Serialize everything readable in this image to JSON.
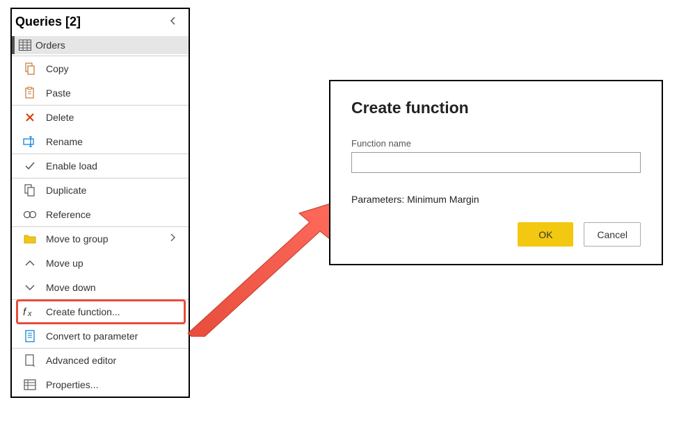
{
  "panel": {
    "title": "Queries [2]",
    "query_name": "Orders"
  },
  "menu": {
    "copy": "Copy",
    "paste": "Paste",
    "delete": "Delete",
    "rename": "Rename",
    "enable_load": "Enable load",
    "duplicate": "Duplicate",
    "reference": "Reference",
    "move_to_group": "Move to group",
    "move_up": "Move up",
    "move_down": "Move down",
    "create_function": "Create function...",
    "convert_to_parameter": "Convert to parameter",
    "advanced_editor": "Advanced editor",
    "properties": "Properties..."
  },
  "dialog": {
    "title": "Create function",
    "field_label": "Function name",
    "input_value": "",
    "parameters_text": "Parameters: Minimum Margin",
    "ok": "OK",
    "cancel": "Cancel"
  }
}
